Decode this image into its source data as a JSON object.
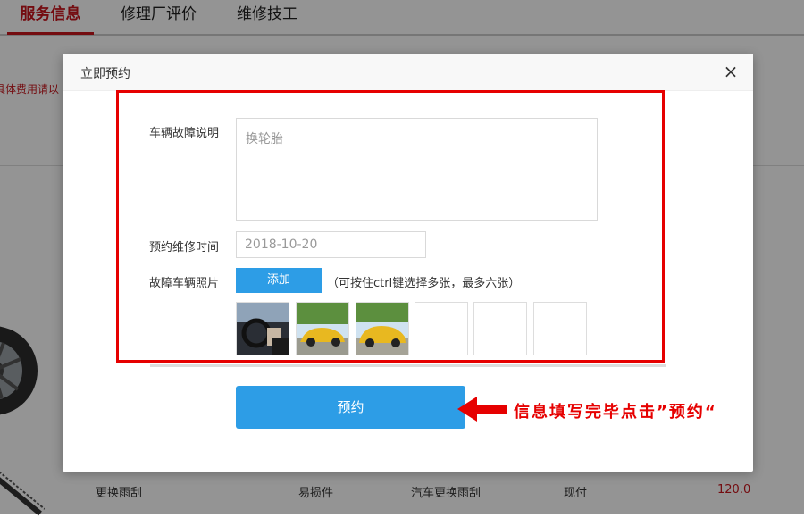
{
  "tabs": [
    "服务信息",
    "修理厂评价",
    "维修技工"
  ],
  "background": {
    "note_fragment": "具体费用请以",
    "row": {
      "name": "更换雨刮",
      "type": "易损件",
      "item": "汽车更换雨刮",
      "payment": "现付",
      "price": "120.0"
    }
  },
  "dialog": {
    "title": "立即预约",
    "close_symbol": "×",
    "fault_label": "车辆故障说明",
    "fault_value": "换轮胎",
    "time_label": "预约维修时间",
    "time_value": "2018-10-20",
    "photo_label": "故障车辆照片",
    "add_button": "添加",
    "photo_hint": "（可按住ctrl键选择多张，最多六张）",
    "submit_button": "预约",
    "photo_slots": 6,
    "filled_photos": 3
  },
  "annotation": {
    "text": "信息填写完毕点击”预约“",
    "color": "#e60000"
  },
  "colors": {
    "accent_red": "#c8161d",
    "button_blue": "#2d9de6"
  }
}
